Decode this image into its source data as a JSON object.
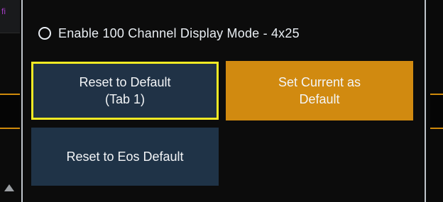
{
  "background": {
    "left_fragment_text": "fi"
  },
  "panel": {
    "radio_option": {
      "label": "Enable 100 Channel Display Mode - 4x25",
      "selected": false
    },
    "buttons": {
      "reset_to_default_tab": {
        "line1": "Reset to Default",
        "line2": "(Tab 1)"
      },
      "set_current_as_default": {
        "line1": "Set Current as",
        "line2": "Default"
      },
      "reset_to_eos_default": {
        "label": "Reset to Eos Default"
      }
    }
  },
  "colors": {
    "panel_bg": "#0c0c0c",
    "button_dark": "#203246",
    "button_amber": "#d18a10",
    "focus_outline": "#f4ea24",
    "text": "#e9eef3"
  }
}
